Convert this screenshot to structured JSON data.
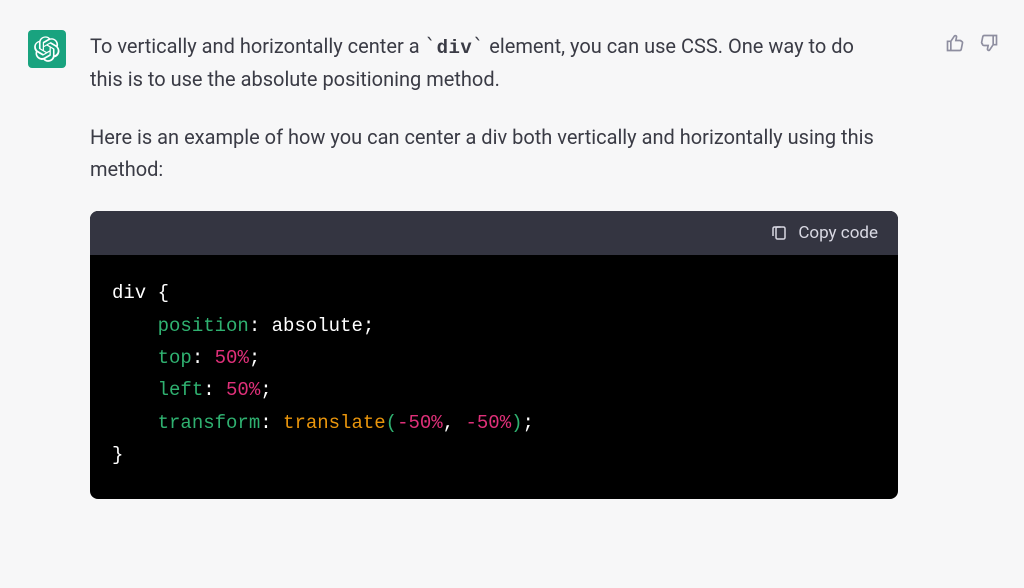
{
  "message": {
    "para1_a": "To vertically and horizontally center a ",
    "para1_code": "div",
    "para1_b": " element, you can use CSS. One way to do this is to use the absolute positioning method.",
    "para2": "Here is an example of how you can center a div both vertically and horizontally using this method:"
  },
  "code": {
    "copy_label": "Copy code",
    "selector": "div",
    "brace_open": "{",
    "brace_close": "}",
    "lines": [
      {
        "prop": "position",
        "val": "absolute"
      },
      {
        "prop": "top",
        "val": "50%"
      },
      {
        "prop": "left",
        "val": "50%"
      },
      {
        "prop": "transform",
        "val": "translate(-50%, -50%)"
      }
    ],
    "transform_func": "translate",
    "transform_arg1": "-50%",
    "transform_arg2": "-50%"
  }
}
